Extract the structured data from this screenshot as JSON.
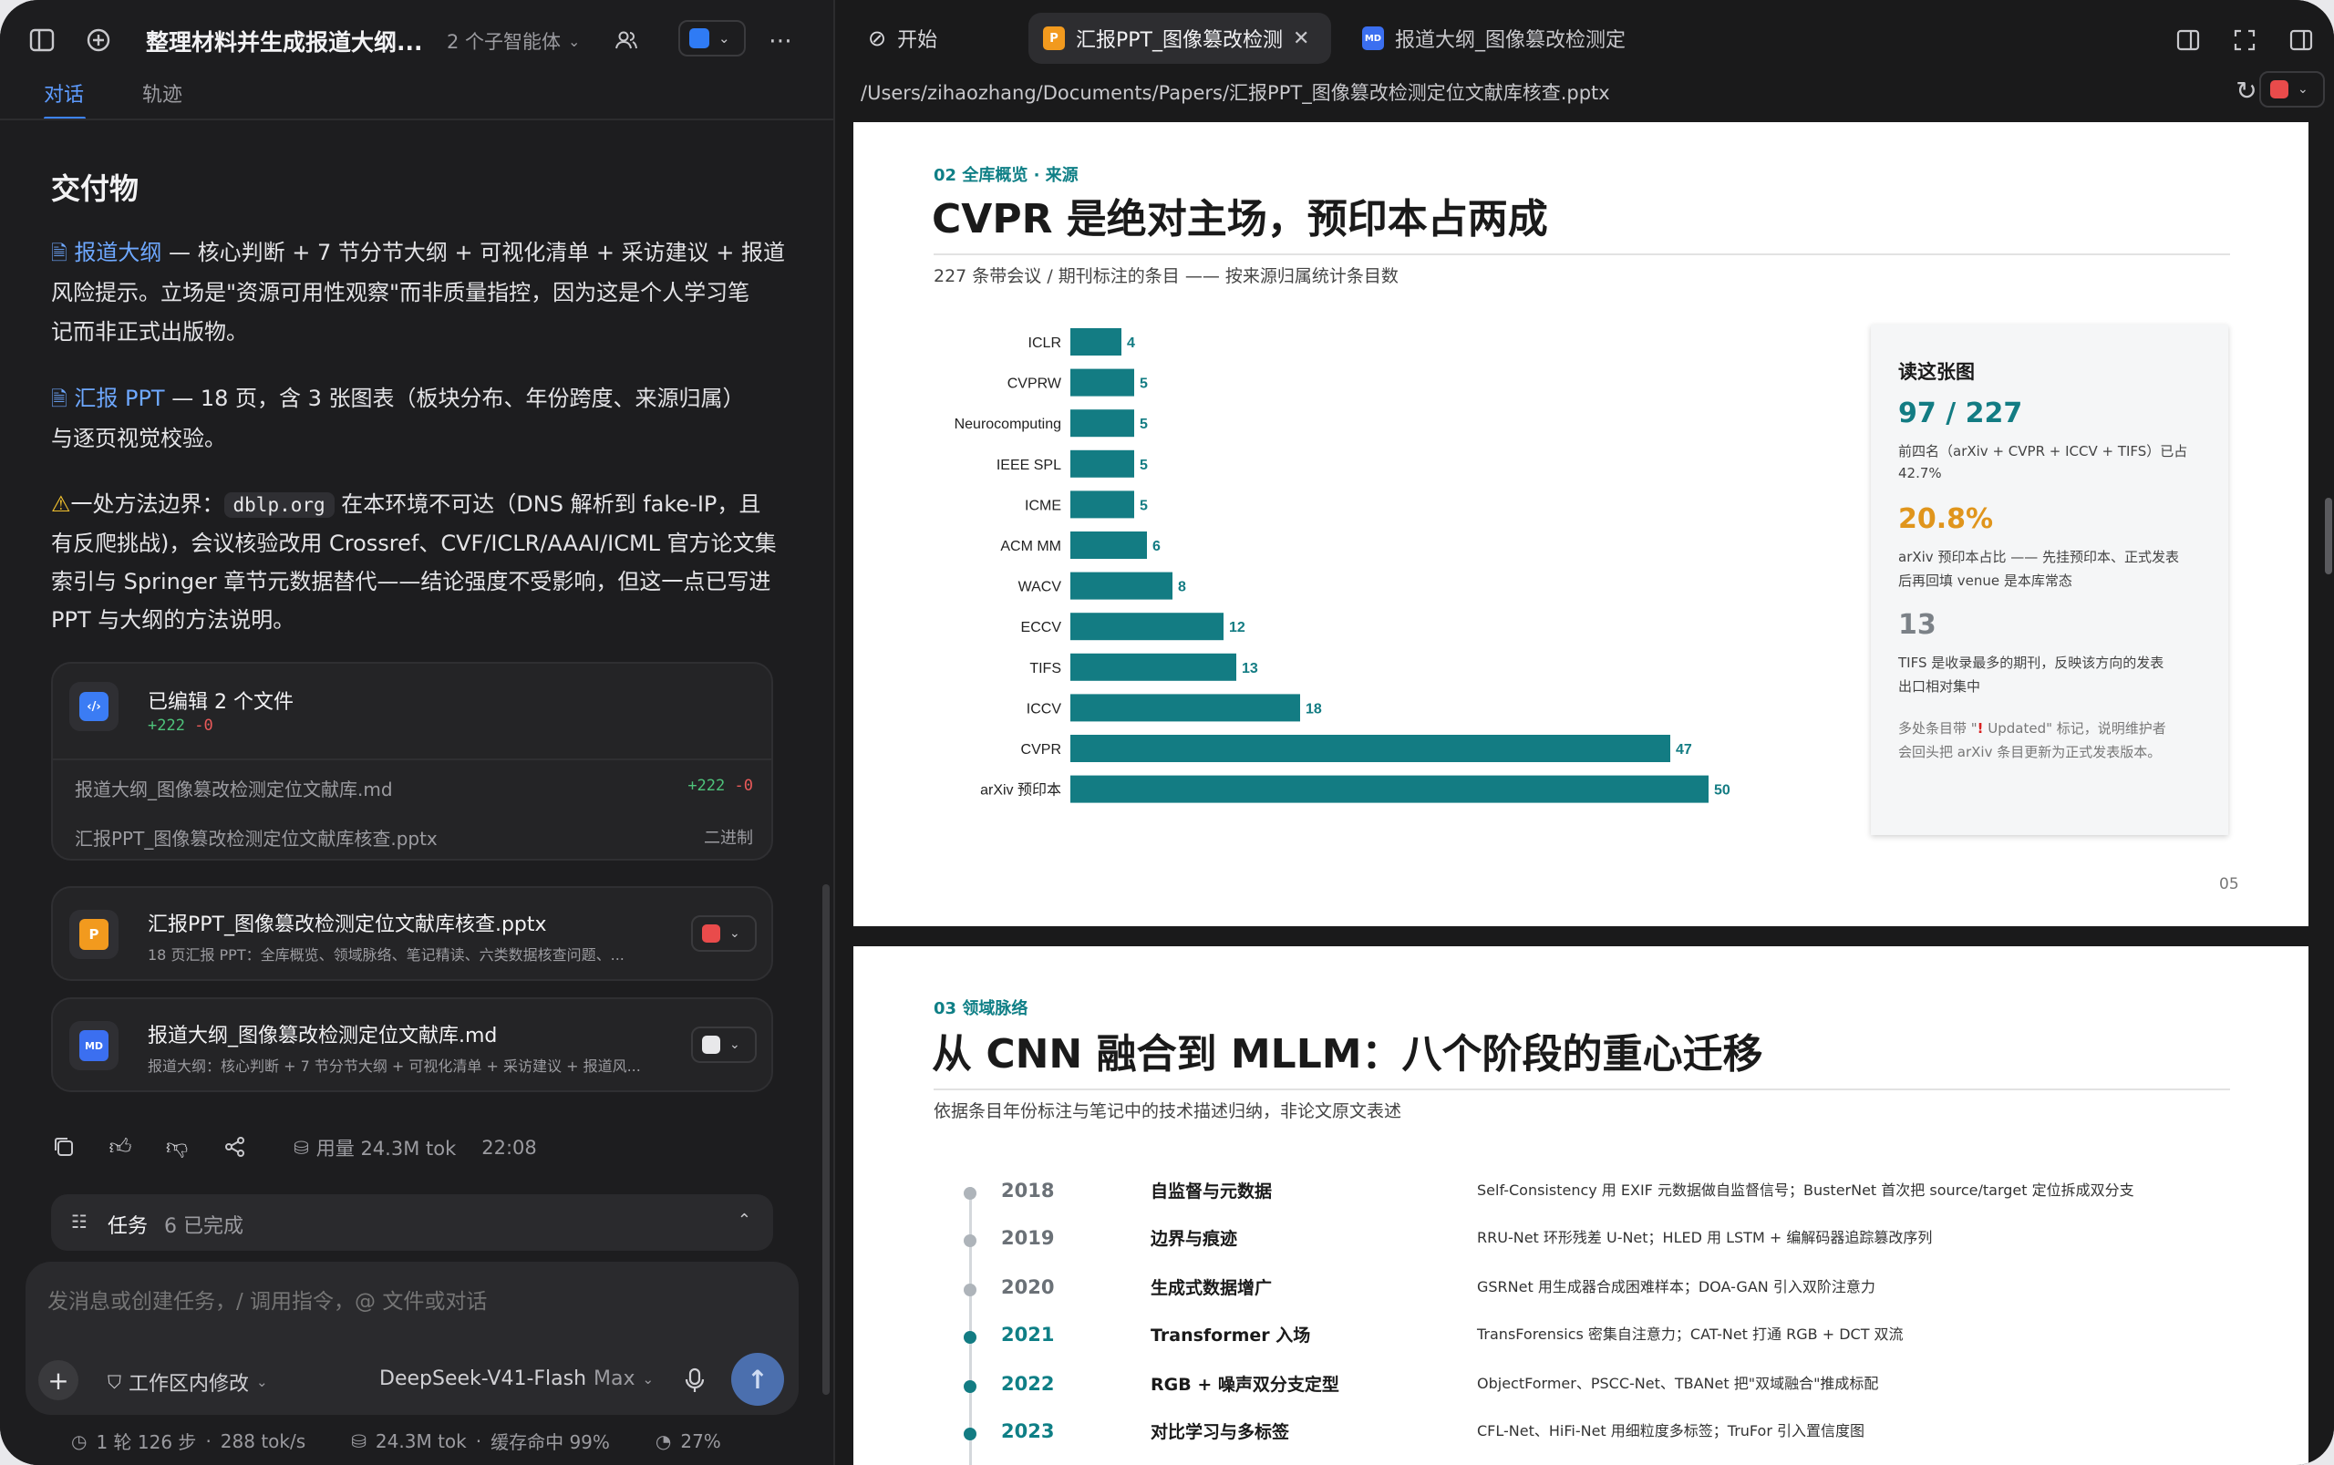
{
  "window": {
    "title": "整理材料并生成报道大纲...",
    "agents_label": "2 个子智能体",
    "tabs": [
      "对话",
      "轨迹"
    ]
  },
  "deliverables": {
    "heading": "交付物",
    "p1_link": "报道大纲",
    "p1_line1": " — 核心判断 + 7 节分节大纲 + 可视化清单 + 采访建议 + 报道",
    "p1_line2": "风险提示。立场是\"资源可用性观察\"而非质量指控，因为这是个人学习笔",
    "p1_line3": "记而非正式出版物。",
    "p2_link": "汇报 PPT",
    "p2_line1": " — 18 页，含 3 张图表（板块分布、年份跨度、来源归属）",
    "p2_line2": "与逐页视觉校验。",
    "p3_pre": "一处方法边界：",
    "p3_code": "dblp.org",
    "p3_line1": " 在本环境不可达（DNS 解析到 fake-IP，且",
    "p3_line2": "有反爬挑战)，会议核验改用 Crossref、CVF/ICLR/AAAI/ICML 官方论文集",
    "p3_line3": "索引与 Springer 章节元数据替代——结论强度不受影响，但这一点已写进",
    "p3_line4": "PPT 与大纲的方法说明。"
  },
  "edited": {
    "title": "已编辑 2 个文件",
    "added": "+222",
    "removed": "-0",
    "files": [
      {
        "name": "报道大纲_图像篡改检测定位文献库.md",
        "added": "+222",
        "removed": "-0"
      },
      {
        "name": "汇报PPT_图像篡改检测定位文献库核查.pptx",
        "status": "二进制"
      }
    ]
  },
  "file_cards": [
    {
      "icon": "P",
      "name": "汇报PPT_图像篡改检测定位文献库核查.pptx",
      "desc": "18 页汇报 PPT：全库概览、领域脉络、笔记精读、六类数据核查问题、..."
    },
    {
      "icon": "MD",
      "name": "报道大纲_图像篡改检测定位文献库.md",
      "desc": "报道大纲：核心判断 + 7 节分节大纲 + 可视化清单 + 采访建议 + 报道风..."
    }
  ],
  "msg_actions": {
    "usage": "用量 24.3M tok",
    "time": "22:08"
  },
  "tasks": {
    "label": "任务",
    "status": "6 已完成"
  },
  "composer": {
    "placeholder": "发消息或创建任务，/ 调用指令，@ 文件或对话",
    "mode": "工作区内修改",
    "model": "DeepSeek-V41-Flash",
    "level": "Max"
  },
  "statusbar": {
    "steps": "1 轮 126 步",
    "speed": "288 tok/s",
    "tokens": "24.3M tok",
    "cache": "缓存命中 99%",
    "context": "27%"
  },
  "preview": {
    "tabs": [
      "开始",
      "汇报PPT_图像篡改检测",
      "报道大纲_图像篡改检测定"
    ],
    "path": "/Users/zihaozhang/Documents/Papers/汇报PPT_图像篡改检测定位文献库核查.pptx"
  },
  "slide1": {
    "section": "02 全库概览 · 来源",
    "title": "CVPR 是绝对主场，预印本占两成",
    "subtitle": "227 条带会议 / 期刊标注的条目 —— 按来源归属统计条目数",
    "page": "05",
    "side": {
      "heading": "读这张图",
      "stat1": "97 / 227",
      "stat1_desc1": "前四名（arXiv + CVPR + ICCV + TIFS）已占",
      "stat1_desc2": "42.7%",
      "stat2": "20.8%",
      "stat2_desc1": "arXiv 预印本占比 —— 先挂预印本、正式发表",
      "stat2_desc2": "后再回填 venue 是本库常态",
      "stat3": "13",
      "stat3_desc1": "TIFS 是收录最多的期刊，反映该方向的发表",
      "stat3_desc2": "出口相对集中",
      "note1_pre": "多处条目带 \"",
      "note1_mark": "!",
      "note1_post": " Updated\" 标记，说明维护者",
      "note2": "会回头把 arXiv 条目更新为正式发表版本。"
    }
  },
  "chart_data": {
    "type": "bar",
    "orientation": "horizontal",
    "categories": [
      "ICLR",
      "CVPRW",
      "Neurocomputing",
      "IEEE SPL",
      "ICME",
      "ACM MM",
      "WACV",
      "ECCV",
      "TIFS",
      "ICCV",
      "CVPR",
      "arXiv 预印本"
    ],
    "values": [
      4,
      5,
      5,
      5,
      5,
      6,
      8,
      12,
      13,
      18,
      47,
      50
    ],
    "bar_color": "#137c83",
    "xlim": [
      0,
      50
    ],
    "grid": false,
    "legend": false
  },
  "slide2": {
    "section": "03 领域脉络",
    "title": "从 CNN 融合到 MLLM：八个阶段的重心迁移",
    "subtitle": "依据条目年份标注与笔记中的技术描述归纳，非论文原文表述",
    "timeline": [
      {
        "year": "2018",
        "title": "自监督与元数据",
        "desc": "Self-Consistency 用 EXIF 元数据做自监督信号；BusterNet 首次把 source/target 定位拆成双分支"
      },
      {
        "year": "2019",
        "title": "边界与痕迹",
        "desc": "RRU-Net 环形残差 U-Net；HLED 用 LSTM + 编解码器追踪篡改序列"
      },
      {
        "year": "2020",
        "title": "生成式数据增广",
        "desc": "GSRNet 用生成器合成困难样本；DOA-GAN 引入双阶注意力"
      },
      {
        "year": "2021",
        "title": "Transformer 入场",
        "desc": "TransForensics 密集自注意力；CAT-Net 打通 RGB + DCT 双流"
      },
      {
        "year": "2022",
        "title": "RGB + 噪声双分支定型",
        "desc": "ObjectFormer、PSCC-Net、TBANet 把\"双域融合\"推成标配"
      },
      {
        "year": "2023",
        "title": "对比学习与多标签",
        "desc": "CFL-Net、HiFi-Net 用细粒度多标签；TruFor 引入置信度图"
      }
    ]
  }
}
